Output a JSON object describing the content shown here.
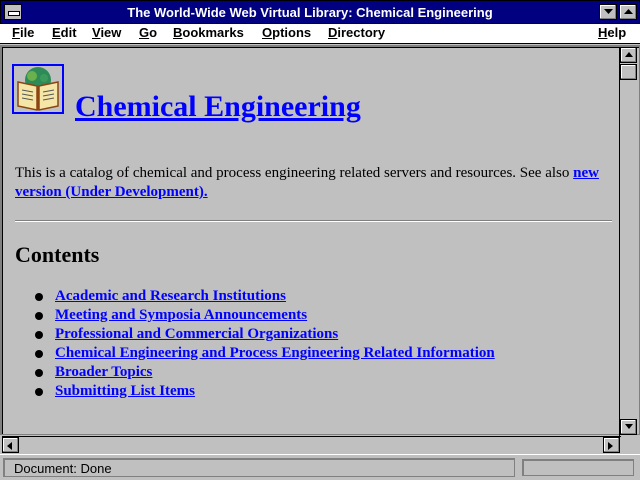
{
  "window": {
    "title": "The World-Wide Web Virtual Library: Chemical Engineering"
  },
  "menu": [
    "File",
    "Edit",
    "View",
    "Go",
    "Bookmarks",
    "Options",
    "Directory",
    "Help"
  ],
  "page": {
    "heading": "Chemical Engineering",
    "intro_text": "This is a catalog of chemical and process engineering related servers and resources. See also ",
    "intro_link": "new version (Under Development).",
    "contents_title": "Contents",
    "toc": [
      "Academic and Research Institutions",
      "Meeting and Symposia Announcements",
      "Professional and Commercial Organizations",
      "Chemical Engineering and Process Engineering Related Information",
      "Broader Topics",
      "Submitting List Items"
    ]
  },
  "status": {
    "text": "Document: Done"
  },
  "colors": {
    "titlebar": "#000080",
    "link": "#0000ff",
    "background": "#c0c0c0"
  },
  "icons": [
    "system-menu-icon",
    "minimize-icon",
    "maximize-icon",
    "book-logo-icon",
    "scroll-up-icon",
    "scroll-down-icon",
    "scroll-left-icon",
    "scroll-right-icon"
  ]
}
